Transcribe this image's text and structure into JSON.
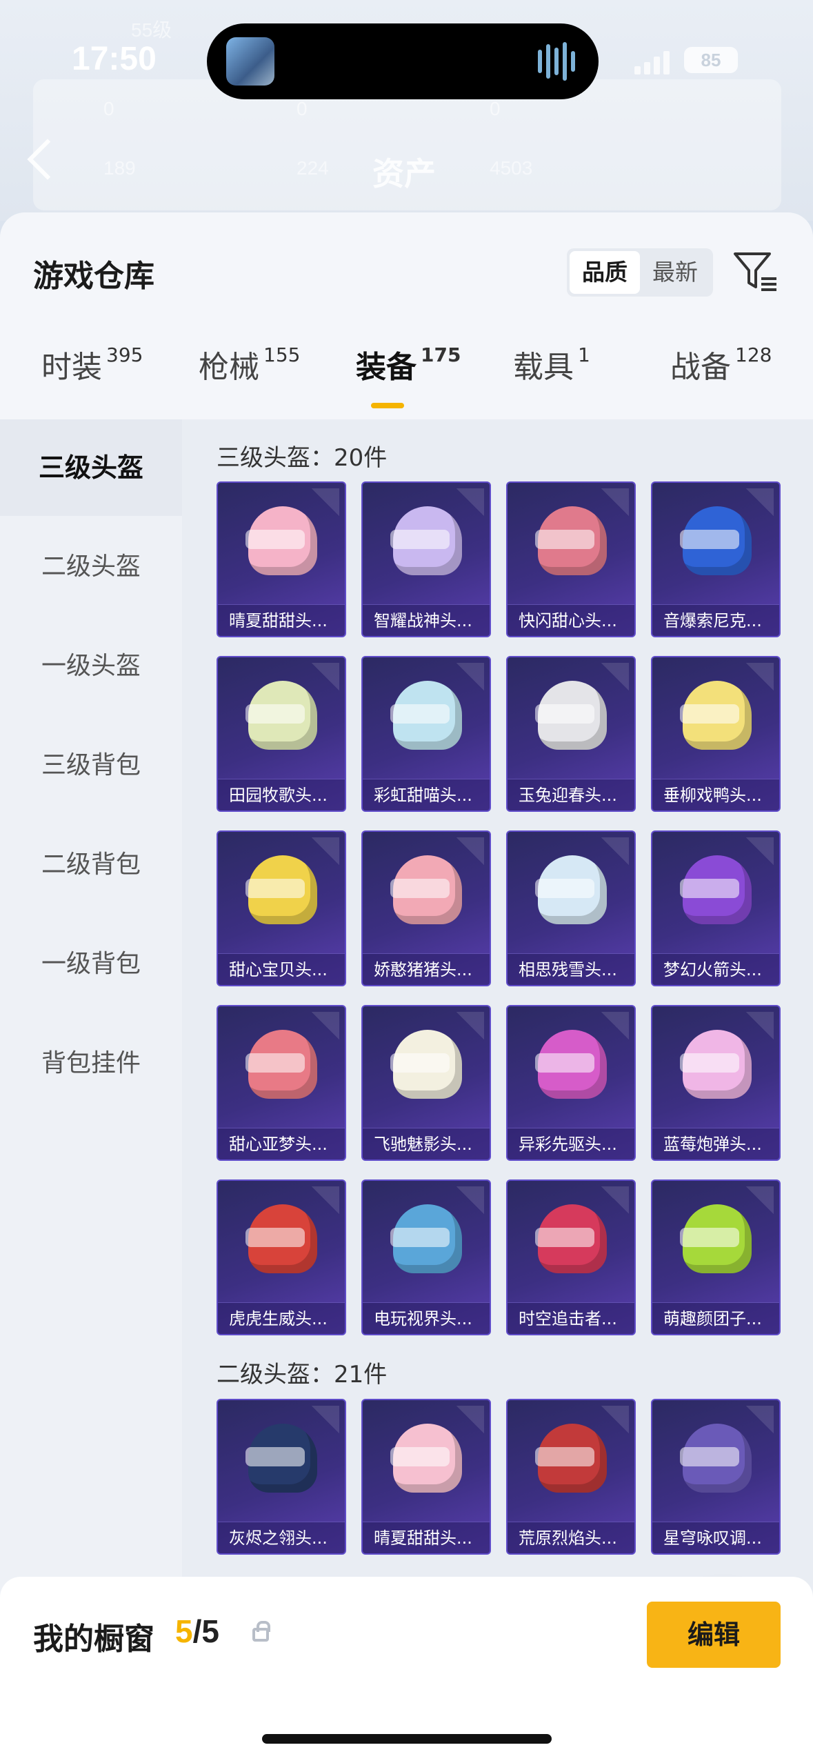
{
  "status_bar": {
    "time": "17:50",
    "battery": "85"
  },
  "background": {
    "level": "55级",
    "title": "资产",
    "stats": [
      "0",
      "0",
      "0",
      "189",
      "224",
      "4503"
    ]
  },
  "sheet": {
    "title": "游戏仓库",
    "sort": {
      "quality": "品质",
      "latest": "最新"
    },
    "tabs": [
      {
        "label": "时装",
        "count": "395"
      },
      {
        "label": "枪械",
        "count": "155"
      },
      {
        "label": "装备",
        "count": "175"
      },
      {
        "label": "载具",
        "count": "1"
      },
      {
        "label": "战备",
        "count": "128"
      }
    ],
    "active_tab": "装备",
    "sidebar": [
      "三级头盔",
      "二级头盔",
      "一级头盔",
      "三级背包",
      "二级背包",
      "一级背包",
      "背包挂件"
    ],
    "sections": [
      {
        "label": "三级头盔：20件",
        "items": [
          {
            "name": "晴夏甜甜头...",
            "color": "#f5b3c8"
          },
          {
            "name": "智耀战神头...",
            "color": "#c9b8f0"
          },
          {
            "name": "快闪甜心头...",
            "color": "#e07a8c"
          },
          {
            "name": "音爆索尼克...",
            "color": "#2f63d6"
          },
          {
            "name": "田园牧歌头...",
            "color": "#dfe8b8"
          },
          {
            "name": "彩虹甜喵头...",
            "color": "#bfe3f0"
          },
          {
            "name": "玉兔迎春头...",
            "color": "#e4e4e8"
          },
          {
            "name": "垂柳戏鸭头...",
            "color": "#f3e07a"
          },
          {
            "name": "甜心宝贝头...",
            "color": "#f0d24a"
          },
          {
            "name": "娇憨猪猪头...",
            "color": "#f2a9b5"
          },
          {
            "name": "相思残雪头...",
            "color": "#d6e8f5"
          },
          {
            "name": "梦幻火箭头...",
            "color": "#8a4bd6"
          },
          {
            "name": "甜心亚梦头...",
            "color": "#e87a86"
          },
          {
            "name": "飞驰魅影头...",
            "color": "#f3f0e0"
          },
          {
            "name": "异彩先驱头...",
            "color": "#d65cc9"
          },
          {
            "name": "蓝莓炮弹头...",
            "color": "#f0b6e6"
          },
          {
            "name": "虎虎生威头...",
            "color": "#d8433a"
          },
          {
            "name": "电玩视界头...",
            "color": "#5aa6d9"
          },
          {
            "name": "时空追击者...",
            "color": "#d63a5c"
          },
          {
            "name": "萌趣颜团子...",
            "color": "#a6d93a"
          }
        ]
      },
      {
        "label": "二级头盔：21件",
        "items": [
          {
            "name": "灰烬之翎头...",
            "color": "#263a6b"
          },
          {
            "name": "晴夏甜甜头...",
            "color": "#f6c0d0"
          },
          {
            "name": "荒原烈焰头...",
            "color": "#c23a3a"
          },
          {
            "name": "星穹咏叹调...",
            "color": "#6a5ab8"
          }
        ]
      }
    ]
  },
  "showcase": {
    "label": "我的橱窗",
    "current": "5",
    "total": "/5",
    "edit": "编辑"
  }
}
